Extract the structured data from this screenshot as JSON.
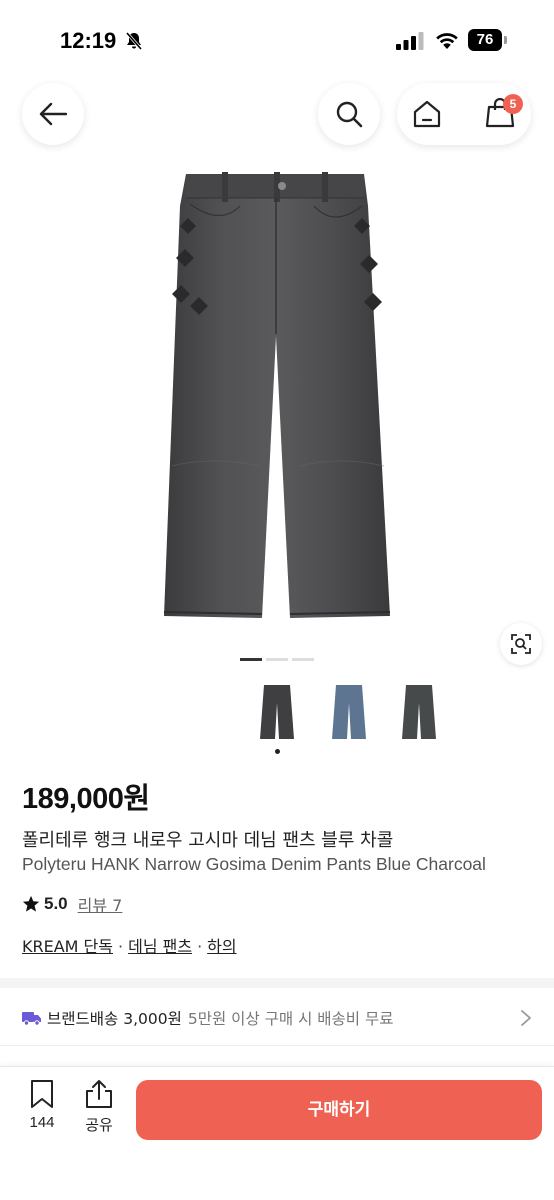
{
  "status_bar": {
    "time": "12:19",
    "battery": "76"
  },
  "nav": {
    "cart_count": "5"
  },
  "product": {
    "price": "189,000원",
    "title_ko": "폴리테루 행크 내로우 고시마 데님 팬츠 블루 차콜",
    "title_en": "Polyteru HANK Narrow Gosima Denim Pants Blue Charcoal",
    "rating": "5.0",
    "review_label": "리뷰 7",
    "categories": [
      "KREAM 단독",
      "데님 팬츠",
      "하의"
    ],
    "category_separator": "·"
  },
  "gallery": {
    "image_count": 3,
    "current_index": 0
  },
  "shipping": {
    "label": "브랜드배송 3,000원",
    "note": "5만원 이상 구매 시 배송비 무료"
  },
  "bottom_bar": {
    "bookmark_count": "144",
    "share_label": "공유",
    "buy_label": "구매하기"
  },
  "colors": {
    "accent": "#ef6253",
    "truck": "#6b5bd6"
  }
}
